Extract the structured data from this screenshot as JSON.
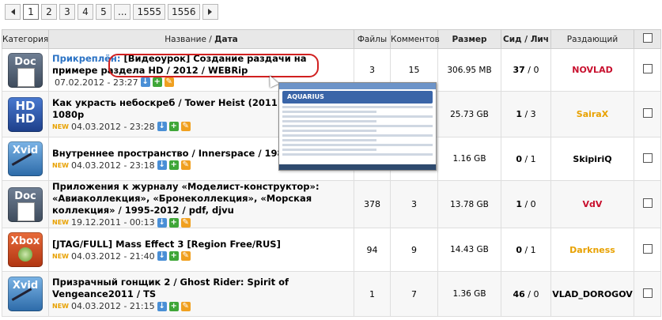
{
  "pager": [
    "1",
    "2",
    "3",
    "4",
    "5",
    "...",
    "1555",
    "1556"
  ],
  "headers": {
    "category": "Категория",
    "name": "Название",
    "sep": " / ",
    "date": "Дата",
    "files": "Файлы",
    "comments": "Комментов",
    "size": "Размер",
    "seeds_leech": "Сид / Лич",
    "uploader": "Раздающий"
  },
  "rows": [
    {
      "icon": "doc",
      "icon_text": "Doc",
      "pinned": "Прикреплён:",
      "title": "[Видеоурок] Создание раздачи на примере раздела HD / 2012 / WEBRip",
      "date": "07.02.2012 - 23:27",
      "new": "",
      "files": "3",
      "comments": "15",
      "size": "306.95 MB",
      "seeds": "37",
      "leech": "0",
      "uploader": "NOVLAD",
      "uploader_color": "#c8102e"
    },
    {
      "icon": "hd",
      "icon_text": "HD",
      "icon_text2": "HD",
      "pinned": "",
      "title": "Как украсть небоскреб / Tower Heist (2011) Blu-Ray 1080p",
      "date": "04.03.2012 - 23:28",
      "new": "NEW",
      "files": "",
      "comments": "",
      "size": "25.73 GB",
      "seeds": "1",
      "leech": "3",
      "uploader": "SairaX",
      "uploader_color": "#e8a100"
    },
    {
      "icon": "xvid",
      "icon_text": "Xvid",
      "pinned": "",
      "title": "Внутреннее пространство / Innerspace / 1987 / DVDRip",
      "date": "04.03.2012 - 23:18",
      "new": "NEW",
      "files": "",
      "comments": "",
      "size": "1.16 GB",
      "seeds": "0",
      "leech": "1",
      "uploader": "SkipiriQ",
      "uploader_color": "#000000"
    },
    {
      "icon": "doc",
      "icon_text": "Doc",
      "pinned": "",
      "title": "Приложения к журналу «Моделист-конструктор»: «Авиаколлекция», «Бронеколлекция», «Морская коллекция» / 1995-2012 / pdf, djvu",
      "date": "19.12.2011 - 00:13",
      "new": "NEW",
      "files": "378",
      "comments": "3",
      "size": "13.78 GB",
      "seeds": "1",
      "leech": "0",
      "uploader": "VdV",
      "uploader_color": "#c8102e"
    },
    {
      "icon": "xbox",
      "icon_text": "Xbox",
      "pinned": "",
      "title": "[JTAG/FULL] Mass Effect 3 [Region Free/RUS]",
      "date": "04.03.2012 - 21:40",
      "new": "NEW",
      "files": "94",
      "comments": "9",
      "size": "14.43 GB",
      "seeds": "0",
      "leech": "1",
      "uploader": "Darkness",
      "uploader_color": "#e8a100"
    },
    {
      "icon": "xvid",
      "icon_text": "Xvid",
      "pinned": "",
      "title": "Призрачный гонщик 2 / Ghost Rider: Spirit of Vengeance2011 / TS",
      "date": "04.03.2012 - 21:15",
      "new": "NEW",
      "files": "1",
      "comments": "7",
      "size": "1.36 GB",
      "seeds": "46",
      "leech": "0",
      "uploader": "VLAD_DOROGOV",
      "uploader_color": "#000000"
    }
  ],
  "preview": {
    "logo": "AQUARIUS"
  }
}
